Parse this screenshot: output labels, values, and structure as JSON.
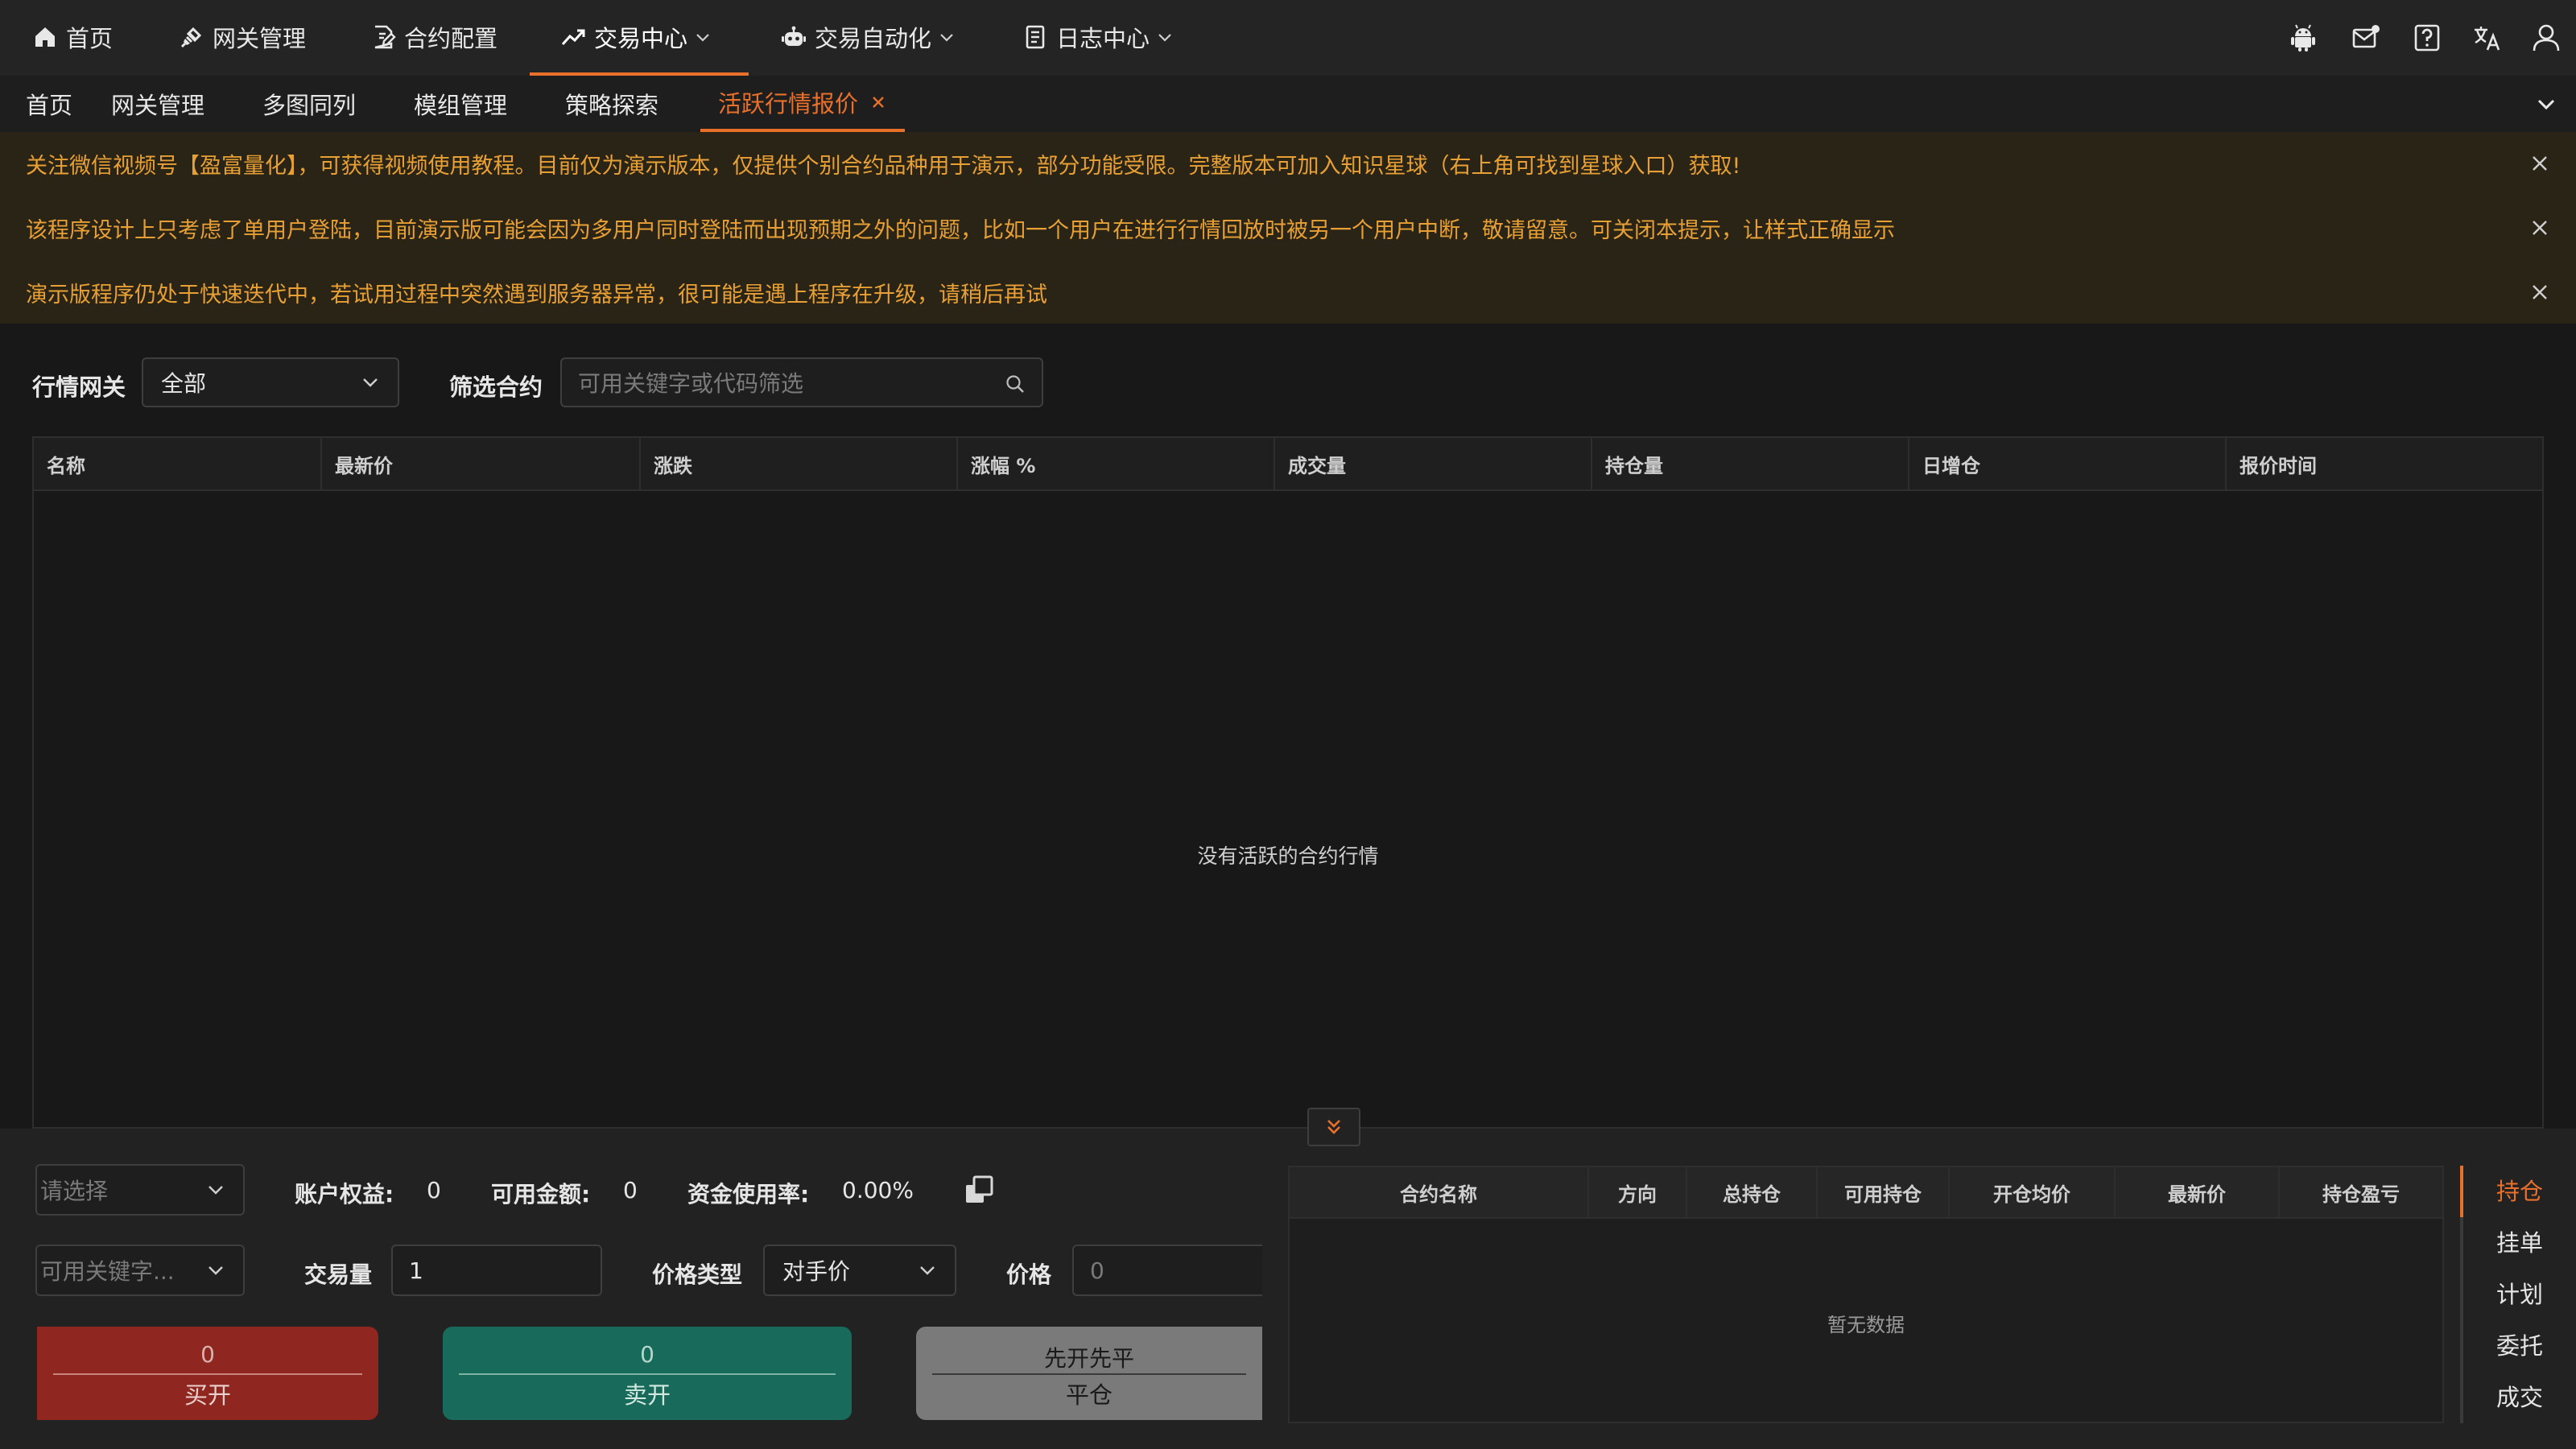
{
  "nav": {
    "items": [
      {
        "label": "首页",
        "icon": "home-icon"
      },
      {
        "label": "网关管理",
        "icon": "plug-icon"
      },
      {
        "label": "合约配置",
        "icon": "file-edit-icon"
      },
      {
        "label": "交易中心",
        "icon": "trend-icon",
        "dropdown": true,
        "active": true
      },
      {
        "label": "交易自动化",
        "icon": "robot-icon",
        "dropdown": true
      },
      {
        "label": "日志中心",
        "icon": "log-icon",
        "dropdown": true
      }
    ],
    "right_icons": [
      "android-icon",
      "mail-icon",
      "help-icon",
      "translate-icon",
      "user-icon"
    ]
  },
  "tabs": [
    {
      "label": "首页"
    },
    {
      "label": "网关管理"
    },
    {
      "label": "多图同列"
    },
    {
      "label": "模组管理"
    },
    {
      "label": "策略探索"
    },
    {
      "label": "活跃行情报价",
      "active": true,
      "closable": true
    }
  ],
  "notices": [
    "关注微信视频号【盈富量化】，可获得视频使用教程。目前仅为演示版本，仅提供个别合约品种用于演示，部分功能受限。完整版本可加入知识星球（右上角可找到星球入口）获取!",
    "该程序设计上只考虑了单用户登陆，目前演示版可能会因为多用户同时登陆而出现预期之外的问题，比如一个用户在进行行情回放时被另一个用户中断，敬请留意。可关闭本提示，让样式正确显示",
    "演示版程序仍处于快速迭代中，若试用过程中突然遇到服务器异常，很可能是遇上程序在升级，请稍后再试"
  ],
  "filter": {
    "gateway_label": "行情网关",
    "gateway_value": "全部",
    "contract_label": "筛选合约",
    "contract_placeholder": "可用关键字或代码筛选"
  },
  "quote_table": {
    "columns": [
      "名称",
      "最新价",
      "涨跌",
      "涨幅 %",
      "成交量",
      "持仓量",
      "日增仓",
      "报价时间"
    ],
    "empty_text": "没有活跃的合约行情"
  },
  "trade": {
    "account_placeholder": "请选择",
    "equity_label": "账户权益:",
    "equity_value": "0",
    "available_label": "可用金额:",
    "available_value": "0",
    "usage_label": "资金使用率:",
    "usage_value": "0.00%",
    "contract_placeholder": "可用关键字...",
    "volume_label": "交易量",
    "volume_value": "1",
    "price_type_label": "价格类型",
    "price_type_value": "对手价",
    "price_label": "价格",
    "price_placeholder": "0",
    "buy": {
      "top": "0",
      "label": "买开"
    },
    "sell": {
      "top": "0",
      "label": "卖开"
    },
    "close": {
      "top": "先开先平",
      "label": "平仓"
    }
  },
  "position_table": {
    "columns": [
      "合约名称",
      "方向",
      "总持仓",
      "可用持仓",
      "开仓均价",
      "最新价",
      "持仓盈亏"
    ],
    "empty_text": "暂无数据"
  },
  "side_tabs": [
    {
      "label": "持仓",
      "active": true
    },
    {
      "label": "挂单"
    },
    {
      "label": "计划"
    },
    {
      "label": "委托"
    },
    {
      "label": "成交"
    }
  ],
  "colors": {
    "accent": "#e8702a",
    "notice_text": "#e8a034",
    "buy": "#8f2620",
    "sell": "#186b5a",
    "close": "#7a7a7a"
  }
}
